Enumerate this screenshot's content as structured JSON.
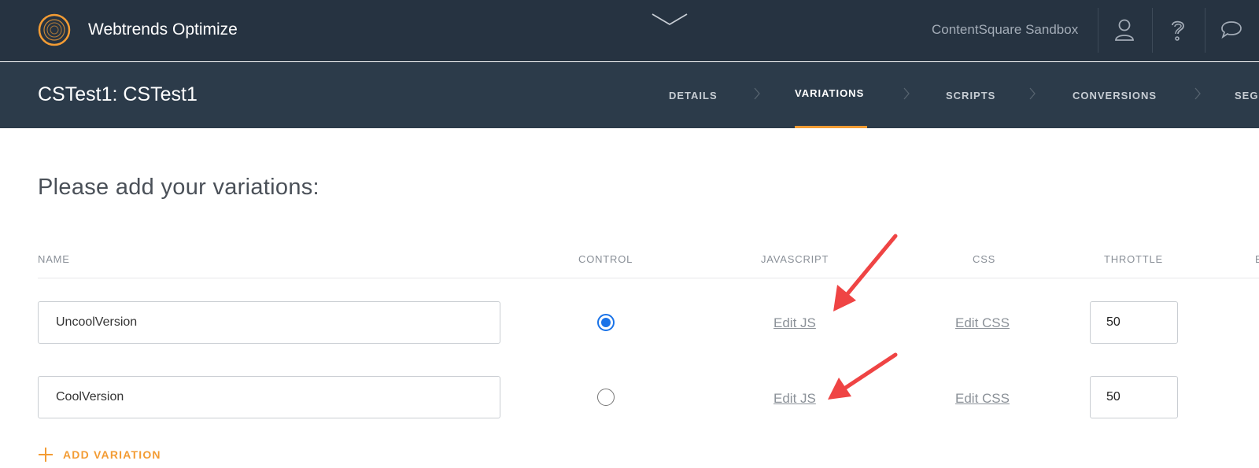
{
  "header": {
    "brand": "Webtrends Optimize",
    "account": "ContentSquare Sandbox",
    "icons": [
      "logo-icon",
      "chevron-down-icon",
      "user-icon",
      "help-icon",
      "chat-icon"
    ]
  },
  "test": {
    "title": "CSTest1: CSTest1"
  },
  "tabs": [
    {
      "label": "DETAILS",
      "active": false
    },
    {
      "label": "VARIATIONS",
      "active": true
    },
    {
      "label": "SCRIPTS",
      "active": false
    },
    {
      "label": "CONVERSIONS",
      "active": false
    },
    {
      "label": "SEG",
      "active": false
    }
  ],
  "main": {
    "heading": "Please add your variations:",
    "columns": [
      "NAME",
      "CONTROL",
      "JAVASCRIPT",
      "CSS",
      "THROTTLE",
      "E"
    ],
    "rows": [
      {
        "name": "UncoolVersion",
        "control": true,
        "js_link": "Edit JS",
        "css_link": "Edit CSS",
        "throttle": "50"
      },
      {
        "name": "CoolVersion",
        "control": false,
        "js_link": "Edit JS",
        "css_link": "Edit CSS",
        "throttle": "50"
      }
    ],
    "add_variation": "ADD VARIATION"
  },
  "colors": {
    "topbar": "#263341",
    "subbar": "#2c3b4a",
    "accent": "#f39c34",
    "radio": "#1a73e8",
    "annotation_arrow": "#ef4444"
  }
}
